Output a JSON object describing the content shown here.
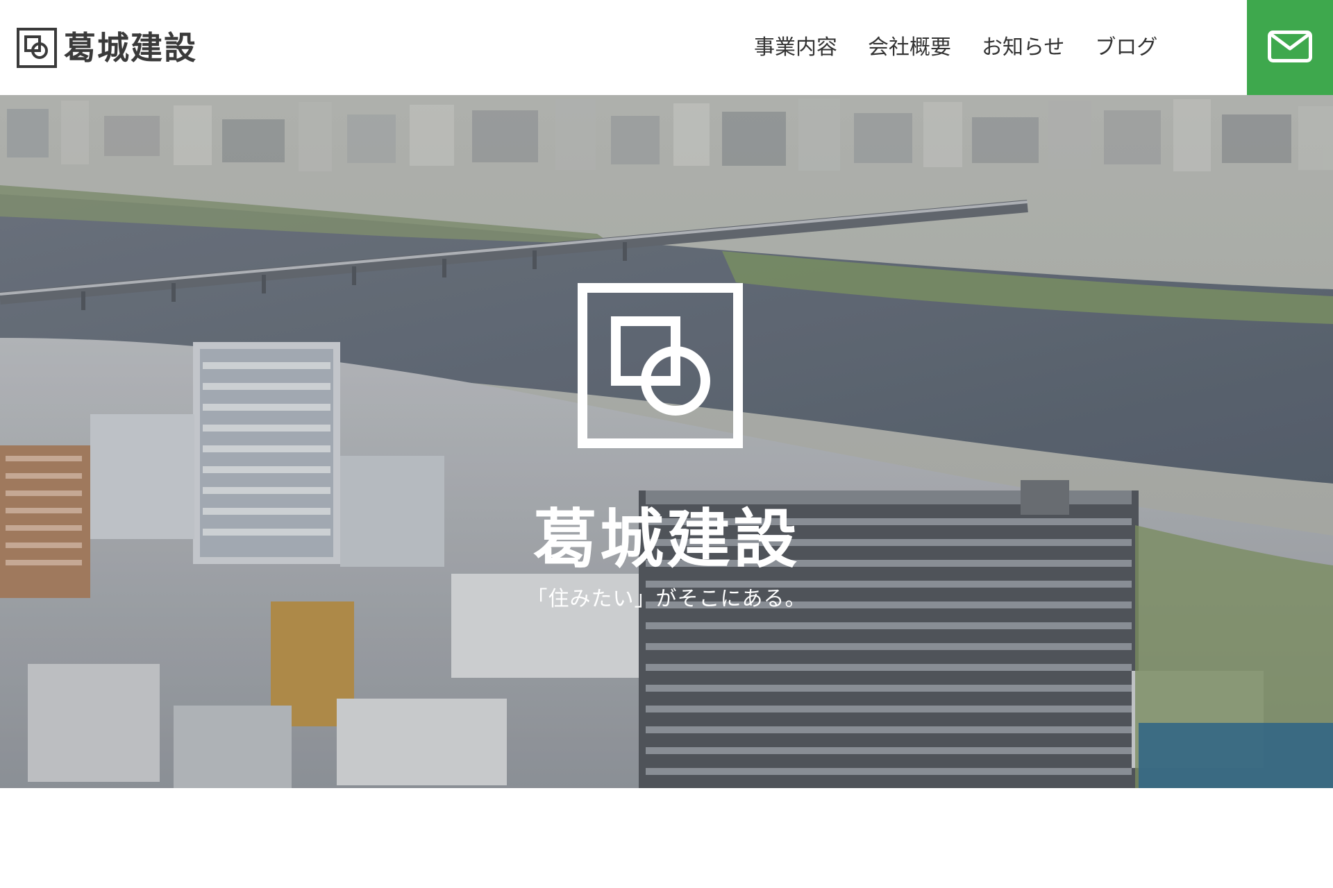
{
  "header": {
    "brand_name": "葛城建設",
    "nav_items": [
      {
        "label": "事業内容"
      },
      {
        "label": "会社概要"
      },
      {
        "label": "お知らせ"
      },
      {
        "label": "ブログ"
      }
    ],
    "mail_icon": "mail-icon",
    "accent_color": "#3ea84d"
  },
  "hero": {
    "title": "葛城建設",
    "tagline": "「住みたい」がそこにある。",
    "background_description_icon": "city-aerial-photo"
  }
}
